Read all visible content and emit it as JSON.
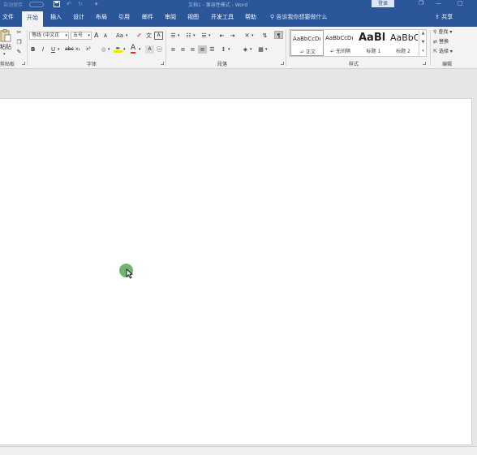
{
  "titlebar": {
    "autosave_label": "自动保存",
    "title": "文档1 - 兼容性模式 - Word",
    "login_label": "登录",
    "restore_glyph": "❐",
    "minimize_glyph": "—",
    "maximize_glyph": "□"
  },
  "tabs": [
    {
      "label": "文件"
    },
    {
      "label": "开始"
    },
    {
      "label": "插入"
    },
    {
      "label": "设计"
    },
    {
      "label": "布局"
    },
    {
      "label": "引用"
    },
    {
      "label": "邮件"
    },
    {
      "label": "审阅"
    },
    {
      "label": "视图"
    },
    {
      "label": "开发工具"
    },
    {
      "label": "帮助"
    }
  ],
  "tellme": {
    "placeholder": "告诉我你想要做什么"
  },
  "share": {
    "label": "共享"
  },
  "ribbon": {
    "clipboard": {
      "paste_label": "粘贴",
      "group_label": "剪贴板"
    },
    "font": {
      "font_name": "等线 (中文正",
      "font_size": "五号",
      "grow": "A",
      "shrink": "A",
      "change_case": "Aa",
      "bold": "B",
      "italic": "I",
      "underline": "U",
      "strike": "abc",
      "subscript": "x₂",
      "superscript": "x²",
      "font_color": "A",
      "group_label": "字体"
    },
    "paragraph": {
      "group_label": "段落"
    },
    "styles": {
      "items": [
        {
          "preview": "AaBbCcDı",
          "name": "↵ 正文"
        },
        {
          "preview": "AaBbCcDı",
          "name": "↵ 无间隔"
        },
        {
          "preview": "AaBl",
          "name": "标题 1"
        },
        {
          "preview": "AaBbC",
          "name": "标题 2"
        }
      ],
      "group_label": "样式"
    },
    "editing": {
      "find": "查找",
      "replace": "替换",
      "select": "选择",
      "group_label": "编辑"
    }
  },
  "colors": {
    "brand": "#2b579a",
    "ribbon_bg": "#f3f3f3",
    "workspace": "#e6e6e6",
    "cursor_highlight": "#5fae65"
  },
  "icons": [
    "save-icon",
    "undo-icon",
    "redo-icon",
    "search-icon",
    "share-icon",
    "cut-icon",
    "copy-icon",
    "format-painter-icon",
    "find-icon",
    "replace-icon",
    "select-icon"
  ]
}
